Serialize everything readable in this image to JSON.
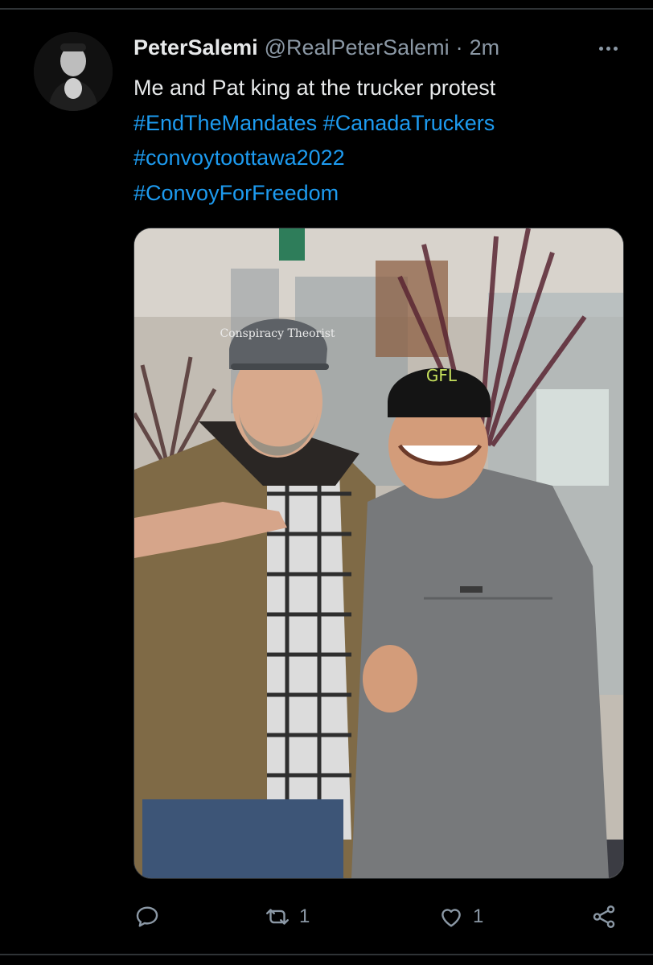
{
  "tweet": {
    "display_name": "PeterSalemi",
    "handle": "@RealPeterSalemi",
    "separator": "·",
    "time": "2m",
    "text": "Me and Pat king at the trucker protest",
    "hashtags": [
      "#EndTheMandates",
      "#CanadaTruckers",
      "#convoytoottawa2022",
      "#ConvoyForFreedom"
    ]
  },
  "media": {
    "photo_description_icon": "photo-two-men-indoors",
    "cap_text": "Conspiracy Theorist",
    "beanie_text": "GFL"
  },
  "actions": {
    "reply_count": "",
    "retweet_count": "1",
    "like_count": "1"
  },
  "icons": {
    "reply": "reply-icon",
    "retweet": "retweet-icon",
    "like": "heart-icon",
    "share": "share-icon",
    "more": "more-icon"
  },
  "colors": {
    "background": "#000000",
    "text": "#e7e9ea",
    "secondary": "#8b98a5",
    "link": "#1d9bf0"
  }
}
